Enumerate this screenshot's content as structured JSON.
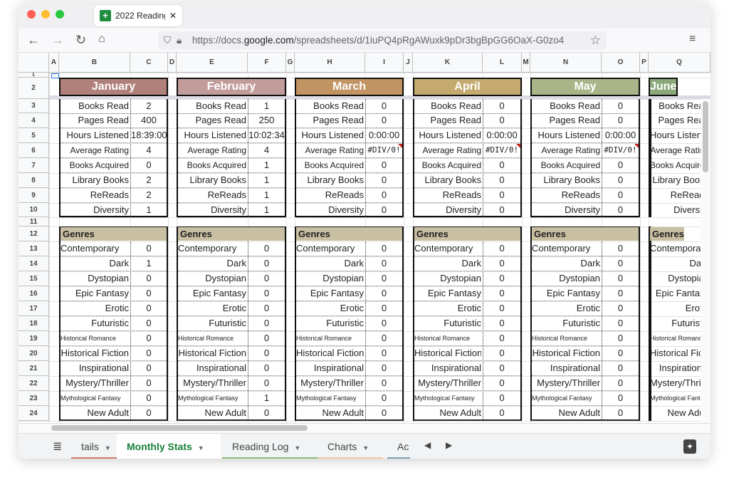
{
  "browser": {
    "tab_title": "2022 Reading",
    "url_prefix": "https://docs.",
    "url_domain": "google.com",
    "url_path": "/spreadsheets/d/1iuPQ4pRgAWuxk9pDr3bgBpGG6OaX-G0zo4"
  },
  "columns": [
    "A",
    "B",
    "C",
    "D",
    "E",
    "F",
    "G",
    "H",
    "I",
    "J",
    "K",
    "L",
    "M",
    "N",
    "O",
    "P",
    "Q"
  ],
  "rows": [
    "1",
    "2",
    "3",
    "4",
    "5",
    "6",
    "7",
    "8",
    "9",
    "10",
    "11",
    "12",
    "13",
    "14",
    "15",
    "16",
    "17",
    "18",
    "19",
    "20",
    "21",
    "22",
    "23",
    "24"
  ],
  "stat_labels": [
    "Books Read",
    "Pages Read",
    "Hours Listened",
    "Average Rating",
    "Books Acquired",
    "Library Books",
    "ReReads",
    "Diversity"
  ],
  "genres_title": "Genres",
  "genre_labels": [
    "Contemporary",
    "Dark",
    "Dystopian",
    "Epic Fantasy",
    "Erotic",
    "Futuristic",
    "Historical Romance",
    "Historical Fiction",
    "Inspirational",
    "Mystery/Thriller",
    "Mythological Fantasy",
    "New Adult"
  ],
  "months": [
    {
      "name": "January",
      "color": "#b0807b",
      "stats": [
        "2",
        "400",
        "18:39:00",
        "4",
        "0",
        "2",
        "2",
        "1"
      ],
      "genres": [
        "0",
        "1",
        "0",
        "0",
        "0",
        "0",
        "0",
        "0",
        "0",
        "0",
        "0",
        "0"
      ]
    },
    {
      "name": "February",
      "color": "#c29c9b",
      "stats": [
        "1",
        "250",
        "10:02:34",
        "4",
        "1",
        "1",
        "1",
        "1"
      ],
      "genres": [
        "0",
        "0",
        "0",
        "0",
        "0",
        "0",
        "0",
        "0",
        "0",
        "0",
        "1",
        "0"
      ]
    },
    {
      "name": "March",
      "color": "#c29363",
      "stats": [
        "0",
        "0",
        "0:00:00",
        "#DIV/0!",
        "0",
        "0",
        "0",
        "0"
      ],
      "genres": [
        "0",
        "0",
        "0",
        "0",
        "0",
        "0",
        "0",
        "0",
        "0",
        "0",
        "0",
        "0"
      ]
    },
    {
      "name": "April",
      "color": "#c4aa6f",
      "stats": [
        "0",
        "0",
        "0:00:00",
        "#DIV/0!",
        "0",
        "0",
        "0",
        "0"
      ],
      "genres": [
        "0",
        "0",
        "0",
        "0",
        "0",
        "0",
        "0",
        "0",
        "0",
        "0",
        "0",
        "0"
      ]
    },
    {
      "name": "May",
      "color": "#a9b489",
      "stats": [
        "0",
        "0",
        "0:00:00",
        "#DIV/0!",
        "0",
        "0",
        "0",
        "0"
      ],
      "genres": [
        "0",
        "0",
        "0",
        "0",
        "0",
        "0",
        "0",
        "0",
        "0",
        "0",
        "0",
        "0"
      ]
    },
    {
      "name": "June",
      "color": "#8aa87a",
      "stats": [],
      "genres": []
    }
  ],
  "sheet_tabs": [
    {
      "label": "tails",
      "color": "#d07a70"
    },
    {
      "label": "Monthly Stats",
      "color": "",
      "active": true
    },
    {
      "label": "Reading Log",
      "color": "#8dbd78"
    },
    {
      "label": "Charts",
      "color": "#f0c9a0"
    },
    {
      "label": "Ac",
      "color": "#7fa0b4"
    }
  ]
}
